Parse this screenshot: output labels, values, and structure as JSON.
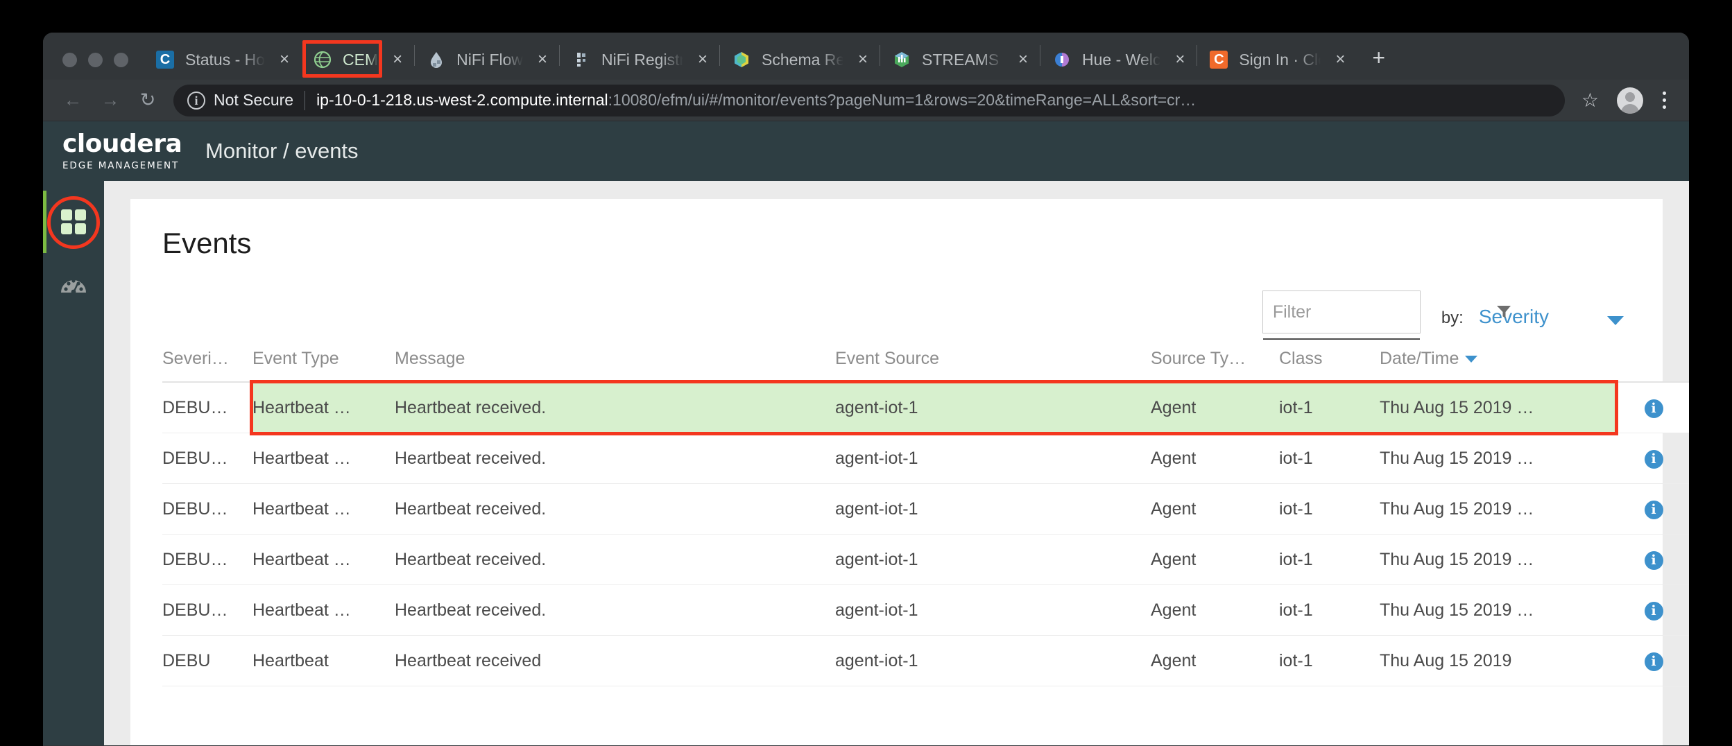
{
  "browser": {
    "traffic_lights": [
      "close",
      "minimize",
      "zoom"
    ],
    "tabs": [
      {
        "title": "Status - Ho",
        "favicon": "cloudera-blue-c-icon",
        "active": false,
        "annotated": false
      },
      {
        "title": "CEM",
        "favicon": "cem-globe-icon",
        "active": true,
        "annotated": true
      },
      {
        "title": "NiFi Flow",
        "favicon": "nifi-drop-icon",
        "active": false,
        "annotated": false
      },
      {
        "title": "NiFi Registr",
        "favicon": "nifi-registry-icon",
        "active": false,
        "annotated": false
      },
      {
        "title": "Schema Re",
        "favicon": "schema-registry-hex-icon",
        "active": false,
        "annotated": false
      },
      {
        "title": "STREAMS M",
        "favicon": "streams-messaging-icon",
        "active": false,
        "annotated": false
      },
      {
        "title": "Hue - Welc",
        "favicon": "hue-icon",
        "active": false,
        "annotated": false
      },
      {
        "title": "Sign In · Clo",
        "favicon": "cloudera-orange-c-icon",
        "active": false,
        "annotated": false
      }
    ],
    "tab_close_label": "×",
    "new_tab_label": "+",
    "nav": {
      "back": "←",
      "forward": "→",
      "reload": "↻"
    },
    "omnibox": {
      "security_icon_glyph": "i",
      "security_text": "Not Secure",
      "url_host": "ip-10-0-1-218.us-west-2.compute.internal",
      "url_path": ":10080/efm/ui/#/monitor/events?pageNum=1&rows=20&timeRange=ALL&sort=cr…",
      "bookmark_star": "☆"
    }
  },
  "app": {
    "brand_name": "cloudera",
    "brand_sub": "EDGE MANAGEMENT",
    "breadcrumb": "Monitor / events",
    "sidebar": [
      {
        "name": "dashboard",
        "icon": "grid-icon",
        "active": true,
        "annotated": true
      },
      {
        "name": "monitor",
        "icon": "gauge-icon",
        "active": false,
        "annotated": false
      }
    ]
  },
  "events": {
    "title": "Events",
    "filter": {
      "value": "",
      "placeholder": "Filter",
      "icon": "funnel-icon"
    },
    "sort": {
      "by_label": "by:",
      "selected": "Severity",
      "caret": "chevron-down-icon"
    },
    "columns": [
      {
        "key": "severity",
        "label": "Severi…"
      },
      {
        "key": "event_type",
        "label": "Event Type"
      },
      {
        "key": "message",
        "label": "Message"
      },
      {
        "key": "event_source",
        "label": "Event Source"
      },
      {
        "key": "source_type",
        "label": "Source Ty…"
      },
      {
        "key": "class",
        "label": "Class"
      },
      {
        "key": "datetime",
        "label": "Date/Time",
        "sorted": true
      },
      {
        "key": "info",
        "label": ""
      }
    ],
    "rows": [
      {
        "severity": "DEBU…",
        "event_type": "Heartbeat …",
        "message": "Heartbeat received.",
        "event_source": "agent-iot-1",
        "source_type": "Agent",
        "class": "iot-1",
        "datetime": "Thu Aug 15 2019 …",
        "info": "i",
        "highlighted": true
      },
      {
        "severity": "DEBU…",
        "event_type": "Heartbeat …",
        "message": "Heartbeat received.",
        "event_source": "agent-iot-1",
        "source_type": "Agent",
        "class": "iot-1",
        "datetime": "Thu Aug 15 2019 …",
        "info": "i",
        "highlighted": false
      },
      {
        "severity": "DEBU…",
        "event_type": "Heartbeat …",
        "message": "Heartbeat received.",
        "event_source": "agent-iot-1",
        "source_type": "Agent",
        "class": "iot-1",
        "datetime": "Thu Aug 15 2019 …",
        "info": "i",
        "highlighted": false
      },
      {
        "severity": "DEBU…",
        "event_type": "Heartbeat …",
        "message": "Heartbeat received.",
        "event_source": "agent-iot-1",
        "source_type": "Agent",
        "class": "iot-1",
        "datetime": "Thu Aug 15 2019 …",
        "info": "i",
        "highlighted": false
      },
      {
        "severity": "DEBU…",
        "event_type": "Heartbeat …",
        "message": "Heartbeat received.",
        "event_source": "agent-iot-1",
        "source_type": "Agent",
        "class": "iot-1",
        "datetime": "Thu Aug 15 2019 …",
        "info": "i",
        "highlighted": false
      },
      {
        "severity": "DEBU",
        "event_type": "Heartbeat",
        "message": "Heartbeat received",
        "event_source": "agent-iot-1",
        "source_type": "Agent",
        "class": "iot-1",
        "datetime": "Thu Aug 15 2019",
        "info": "i",
        "highlighted": false
      }
    ]
  },
  "colors": {
    "annotation_red": "#f4371f",
    "brand_dark": "#2e3e43",
    "accent_green": "#7cbb42",
    "link_blue": "#3d91cc",
    "row_highlight_green": "#d7f0ce"
  }
}
